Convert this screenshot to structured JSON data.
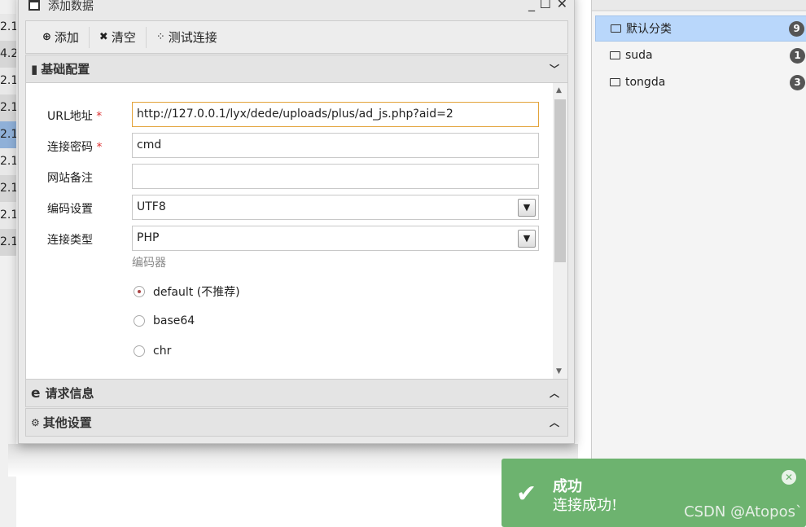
{
  "background_list": {
    "values": [
      "2.1",
      "4.2",
      "2.1",
      "2.1",
      "2.1",
      "2.1",
      "2.1",
      "2.1",
      "2.1"
    ],
    "selected_index": 4
  },
  "dialog": {
    "title": "添加数据",
    "toolbar": {
      "add": "添加",
      "clear": "清空",
      "test": "测试连接"
    },
    "sections": {
      "basic": "基础配置",
      "request": "请求信息",
      "other": "其他设置"
    },
    "form": {
      "url_label": "URL地址",
      "url_value": "http://127.0.0.1/lyx/dede/uploads/plus/ad_js.php?aid=2",
      "password_label": "连接密码",
      "password_value": "cmd",
      "note_label": "网站备注",
      "note_value": "",
      "encoding_label": "编码设置",
      "encoding_value": "UTF8",
      "type_label": "连接类型",
      "type_value": "PHP",
      "encoder_label": "编码器",
      "encoders": [
        "default (不推荐)",
        "base64",
        "chr"
      ],
      "encoder_selected": 0,
      "required_mark": "*"
    }
  },
  "categories": [
    {
      "name": "默认分类",
      "count": "9",
      "selected": true
    },
    {
      "name": "suda",
      "count": "1"
    },
    {
      "name": "tongda",
      "count": "3"
    }
  ],
  "toast": {
    "title": "成功",
    "message": "连接成功!",
    "color": "#6db36f"
  },
  "watermark": "CSDN @Atopos`"
}
